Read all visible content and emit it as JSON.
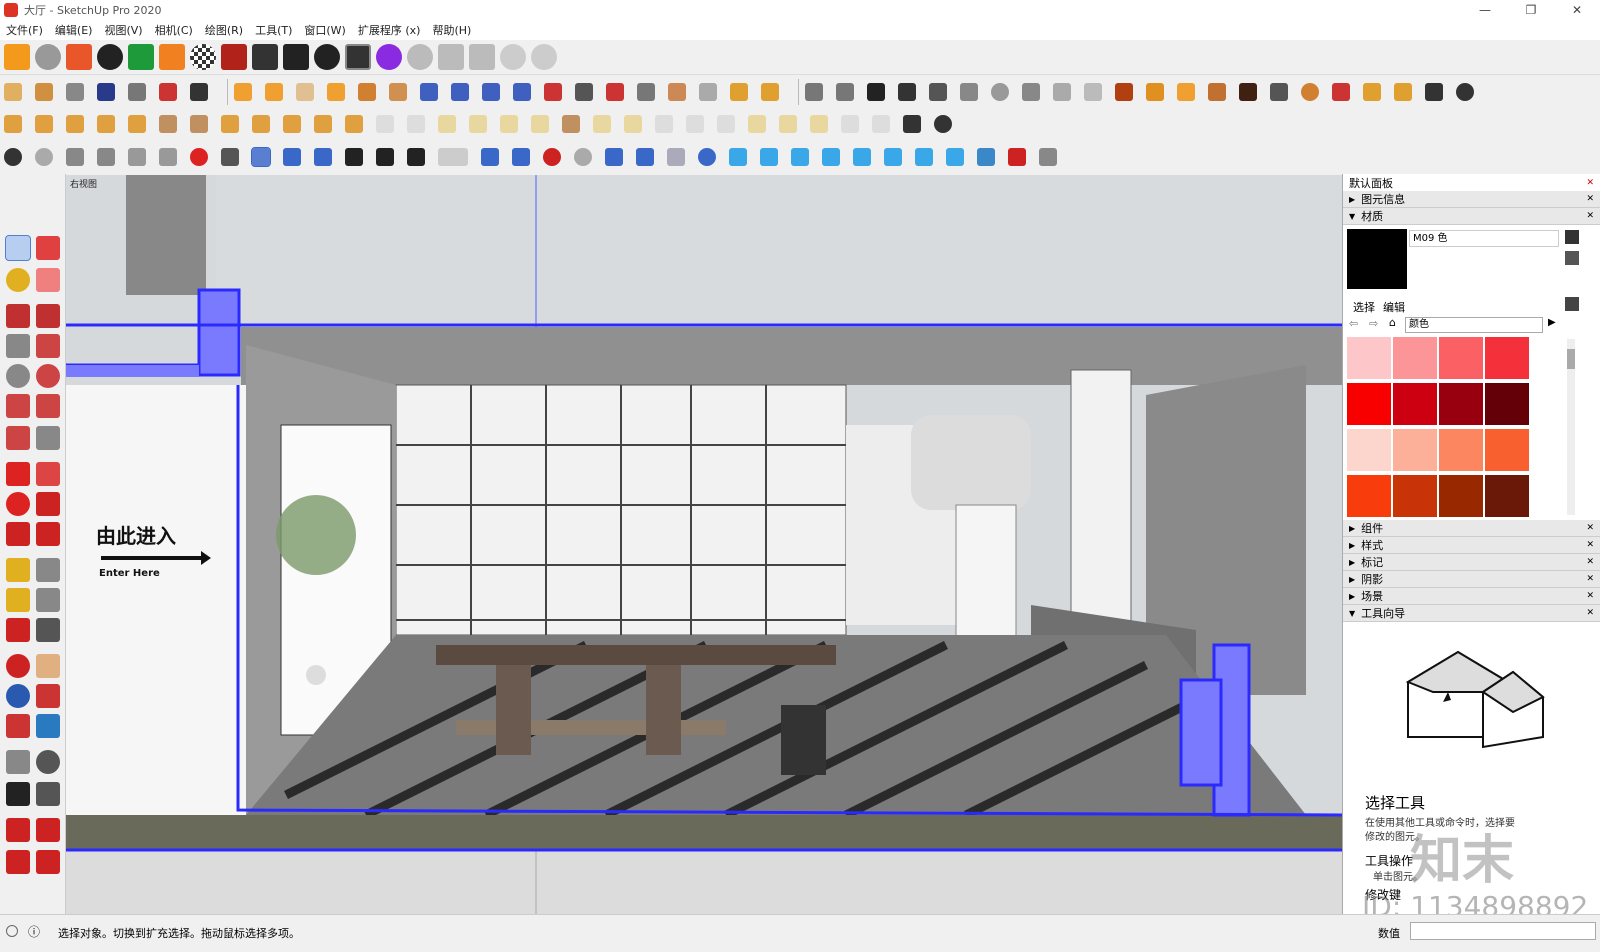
{
  "window": {
    "title": "大厅 - SketchUp Pro 2020",
    "min": "—",
    "max": "❐",
    "close": "✕"
  },
  "menu": [
    "文件(F)",
    "编辑(E)",
    "视图(V)",
    "相机(C)",
    "绘图(R)",
    "工具(T)",
    "窗口(W)",
    "扩展程序 (x)",
    "帮助(H)"
  ],
  "viewport": {
    "view_label": "右视图",
    "sign_title": "由此进入",
    "sign_sub": "Enter Here"
  },
  "panel": {
    "title": "默认面板",
    "sections_top": [
      "图元信息",
      "材质"
    ],
    "material_name": "M09 色",
    "tabs": [
      "选择",
      "编辑"
    ],
    "dropdown": "颜色",
    "swatches": [
      "#fdc6c8",
      "#fc9598",
      "#fb6064",
      "#f4303a",
      "#f90000",
      "#cc0010",
      "#980010",
      "#640008",
      "#fcd6cc",
      "#fcb09a",
      "#fb8660",
      "#f86030",
      "#f83c0c",
      "#c83408",
      "#982800",
      "#6a1808"
    ],
    "sections_bottom": [
      "组件",
      "样式",
      "标记",
      "阴影",
      "场景",
      "工具向导"
    ],
    "guide_title": "选择工具",
    "guide_line1": "在使用其他工具或命令时，选择要",
    "guide_line2": "修改的图元。",
    "guide_ops": "工具操作",
    "guide_ops2": "单击图元。",
    "guide_mod": "修改键"
  },
  "status": {
    "text": "选择对象。切换到扩充选择。拖动鼠标选择多项。",
    "measure_label": "数值"
  },
  "watermark": {
    "brand": "知末",
    "id": "ID: 1134898892"
  },
  "colors": {
    "accent": "#2a2aff",
    "selection": "#7a7aff"
  }
}
